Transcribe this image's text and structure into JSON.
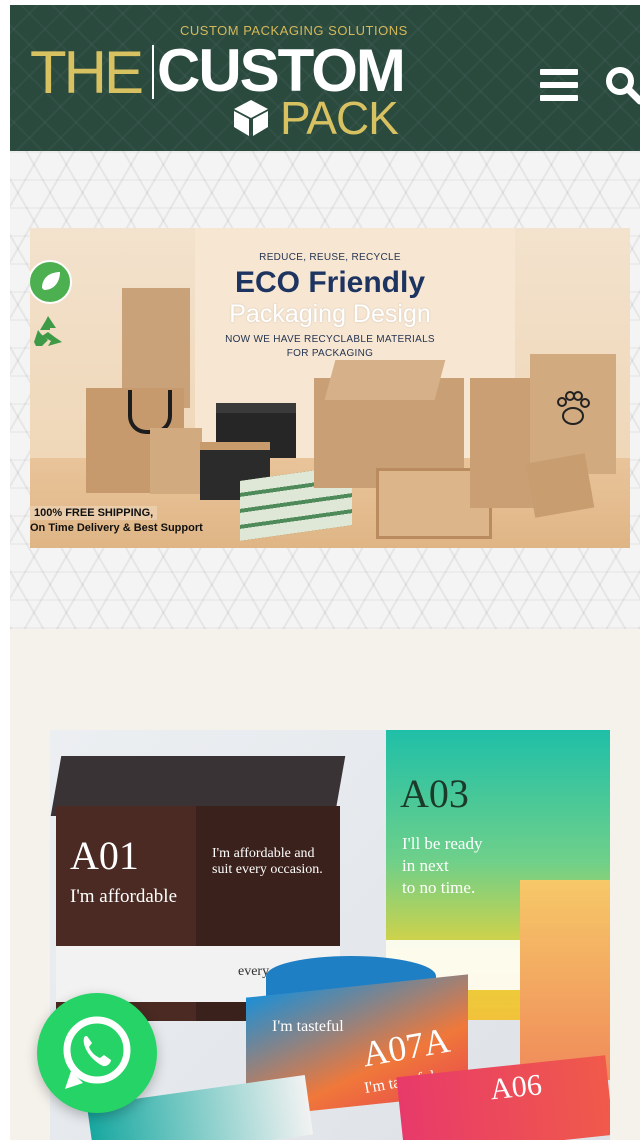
{
  "header": {
    "tagline": "CUSTOM PACKAGING SOLUTIONS",
    "logo_the": "THE",
    "logo_custom": "CUSTOM",
    "logo_pack": "PACK",
    "menu_icon": "hamburger-menu-icon",
    "search_icon": "search-icon",
    "background_color": "#2a4a3e",
    "accent_color": "#d8c160"
  },
  "banner": {
    "kicker": "REDUCE, REUSE, RECYCLE",
    "title": "ECO Friendly",
    "subtitle": "Packaging Design",
    "line1": "NOW WE HAVE RECYCLABLE MATERIALS",
    "line2": "FOR PACKAGING",
    "shipping_line1": "100% FREE SHIPPING,",
    "shipping_line2": "On Time Delivery & Best Support",
    "title_color": "#1d3461"
  },
  "product_photo": {
    "box_a01_code": "A01",
    "box_a01_text": "I'm affordable",
    "box_a01_side": "I'm affordable and suit every occasion.",
    "box_a01_band": "every occasion",
    "box_a03_code": "A03",
    "box_a03_text1": "I'll be ready",
    "box_a03_text2": "in next",
    "box_a03_text3": "to no time.",
    "box_a07a_code": "A07A",
    "box_a07a_text": "I'm tasteful",
    "box_a07a_side": "I'm tasteful",
    "box_a06_code": "A06"
  },
  "whatsapp": {
    "icon": "whatsapp-icon",
    "color": "#25d366"
  }
}
